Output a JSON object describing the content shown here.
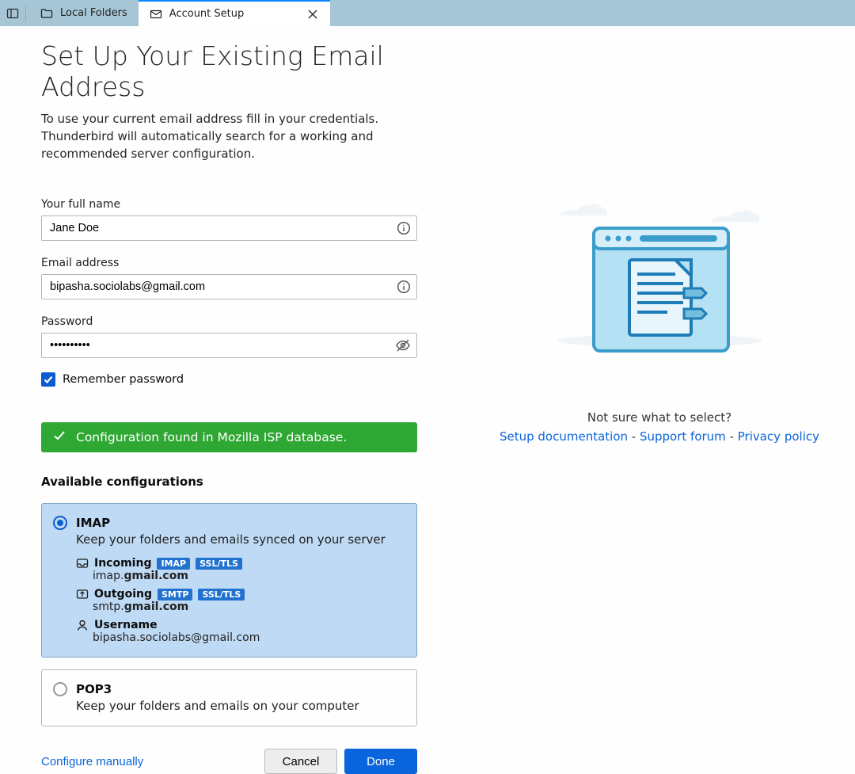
{
  "tabs": {
    "localFolders": "Local Folders",
    "accountSetup": "Account Setup"
  },
  "title": "Set Up Your Existing Email Address",
  "subtext1": "To use your current email address fill in your credentials.",
  "subtext2": "Thunderbird will automatically search for a working and recommended server configuration.",
  "fields": {
    "nameLabel": "Your full name",
    "nameValue": "Jane Doe",
    "emailLabel": "Email address",
    "emailValue": "bipasha.sociolabs@gmail.com",
    "passwordLabel": "Password",
    "passwordValue": "••••••••••",
    "remember": "Remember password"
  },
  "success": "Configuration found in Mozilla ISP database.",
  "availableHeader": "Available configurations",
  "imap": {
    "title": "IMAP",
    "desc": "Keep your folders and emails synced on your server",
    "incoming": "Incoming",
    "inTag1": "IMAP",
    "inTag2": "SSL/TLS",
    "inHostPre": "imap.",
    "inHostBold": "gmail.com",
    "outgoing": "Outgoing",
    "outTag1": "SMTP",
    "outTag2": "SSL/TLS",
    "outHostPre": "smtp.",
    "outHostBold": "gmail.com",
    "userLabel": "Username",
    "username": "bipasha.sociolabs@gmail.com"
  },
  "pop3": {
    "title": "POP3",
    "desc": "Keep your folders and emails on your computer"
  },
  "actions": {
    "manual": "Configure manually",
    "cancel": "Cancel",
    "done": "Done"
  },
  "help": {
    "question": "Not sure what to select?",
    "docs": "Setup documentation",
    "forum": "Support forum",
    "privacy": "Privacy policy",
    "dash": " - "
  }
}
